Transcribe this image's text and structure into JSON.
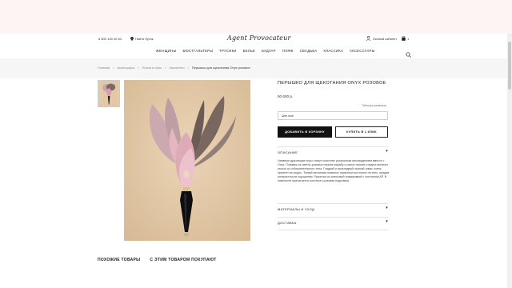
{
  "header": {
    "phone": "8 800 100 40 64",
    "store_finder": "Найти бутик",
    "logo": "Agent Provocateur",
    "account": "Личный кабинет",
    "cart_count": "1"
  },
  "nav": {
    "items": [
      "ЖЕНЩИНЫ",
      "БЮСТГАЛЬТЕРЫ",
      "ТРУСИКИ",
      "БЕЛЬЕ",
      "БУДУАР",
      "ПЛЯЖ",
      "СВАДЬБА",
      "КЛАССИКА",
      "АКСЕССУАРЫ"
    ]
  },
  "breadcrumbs": [
    "Главная",
    "Аксессуары",
    "Пояса и игры",
    "Ласкатели",
    "Перышко для щекотания Onyx розовое"
  ],
  "product": {
    "title": "ПЕРЫШКО ДЛЯ ЩЕКОТАНИЯ ONYX РОЗОВОЕ",
    "price": "50 600 р.",
    "size_table": "Таблица размеров",
    "size_selected": "One size",
    "add_to_cart": "ДОБАВИТЬ В КОРЗИНУ",
    "buy_one_click": "КУПИТЬ В 1 КЛИК",
    "description_label": "ОПИСАНИЕ",
    "description": "Наивные дразнящие игры станут поистине роскошным наслаждением вместе с Onyx. Плюмаж из светло-розовых перьев марабу и серых перьев страуса включит уголок их соблазнительного тела. Гладкий и прохладный черный оникс очень приятен на ощупь. Тонкий механизм позволит прикоснуться нежно на тело, придав контрастности ощущению. Рукоятка из ониксовой гравировкой с логотипом AP. В комплекте прилагается золотисто-розовая подставка.",
    "materials_label": "МАТЕРИАЛЫ И УХОД",
    "delivery_label": "ДОСТАВКА"
  },
  "bottom_tabs": [
    "ПОХОЖИЕ ТОВАРЫ",
    "С ЭТИМ ТОВАРОМ ПОКУПАЮТ"
  ]
}
